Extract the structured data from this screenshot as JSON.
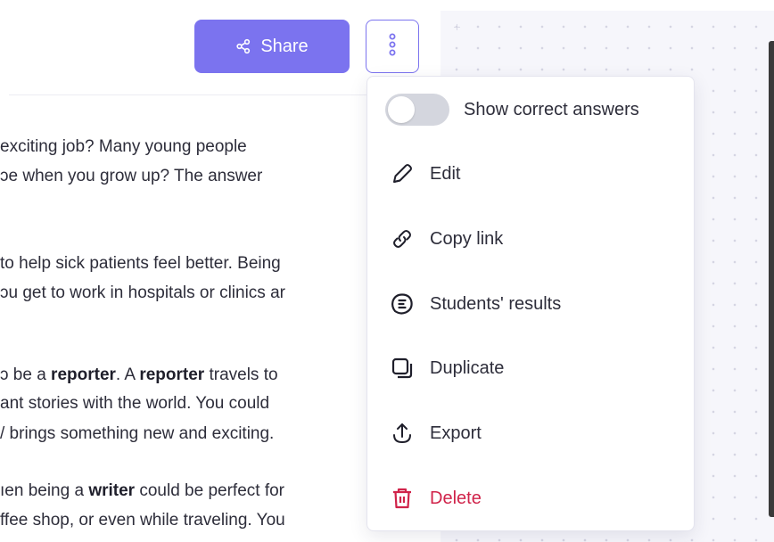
{
  "header": {
    "share_label": "Share"
  },
  "article": {
    "lines": [
      {
        "parts": [
          {
            "t": " exciting job? Many young people",
            "b": false
          }
        ]
      },
      {
        "parts": [
          {
            "t": "ɔe when you grow up? The answer",
            "b": false
          }
        ]
      },
      {
        "parts": [
          {
            "t": " to help sick patients feel better. Being",
            "b": false
          }
        ]
      },
      {
        "parts": [
          {
            "t": "ɔu get to work in hospitals or clinics ar",
            "b": false
          }
        ]
      },
      {
        "parts": [
          {
            "t": "ɔ be a ",
            "b": false
          },
          {
            "t": "reporter",
            "b": true
          },
          {
            "t": ". A ",
            "b": false
          },
          {
            "t": "reporter",
            "b": true
          },
          {
            "t": " travels to",
            "b": false
          }
        ]
      },
      {
        "parts": [
          {
            "t": "ant stories with the world. You could",
            "b": false
          }
        ]
      },
      {
        "parts": [
          {
            "t": "/ brings something new and exciting.",
            "b": false
          }
        ]
      },
      {
        "parts": [
          {
            "t": "ıen being a ",
            "b": false
          },
          {
            "t": "writer",
            "b": true
          },
          {
            "t": " could be perfect for",
            "b": false
          }
        ]
      },
      {
        "parts": [
          {
            "t": " ffee shop, or even while traveling. You",
            "b": false
          }
        ]
      }
    ]
  },
  "menu": {
    "toggle": {
      "label": "Show correct answers",
      "on": false
    },
    "items": [
      {
        "label": "Edit",
        "icon": "pencil-icon"
      },
      {
        "label": "Copy link",
        "icon": "link-icon"
      },
      {
        "label": "Students' results",
        "icon": "results-icon"
      },
      {
        "label": "Duplicate",
        "icon": "duplicate-icon"
      },
      {
        "label": "Export",
        "icon": "export-icon"
      },
      {
        "label": "Delete",
        "icon": "trash-icon"
      }
    ]
  },
  "colors": {
    "accent": "#7b73ef",
    "danger": "#d0234a",
    "text": "#2d2d3a"
  }
}
